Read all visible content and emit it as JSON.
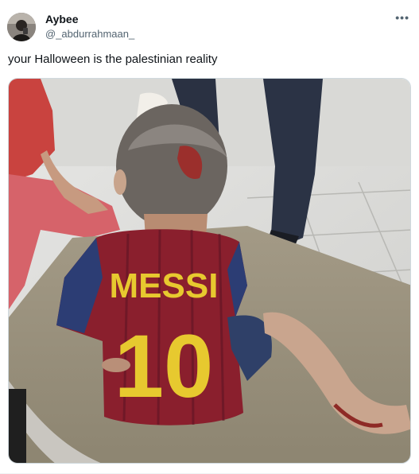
{
  "tweet": {
    "display_name": "Aybee",
    "handle": "@_abdurrahmaan_",
    "text": "your Halloween is the palestinian reality",
    "more_icon": "more-dots-icon",
    "image": {
      "shirt_name": "MESSI",
      "shirt_number": "10"
    }
  }
}
